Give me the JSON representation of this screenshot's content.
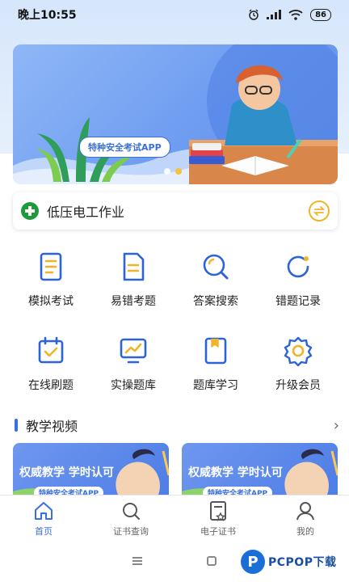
{
  "status_bar": {
    "time": "晚上10:55",
    "battery": "86"
  },
  "banner": {
    "tag": "特种安全考试APP",
    "page_count": 2,
    "active_index": 1
  },
  "job": {
    "title": "低压电工作业"
  },
  "features": [
    {
      "label": "模拟考试",
      "icon": "exam-paper-icon"
    },
    {
      "label": "易错考题",
      "icon": "document-icon"
    },
    {
      "label": "答案搜索",
      "icon": "search-icon"
    },
    {
      "label": "错题记录",
      "icon": "refresh-icon"
    },
    {
      "label": "在线刷题",
      "icon": "calendar-check-icon"
    },
    {
      "label": "实操题库",
      "icon": "monitor-chart-icon"
    },
    {
      "label": "题库学习",
      "icon": "book-icon"
    },
    {
      "label": "升级会员",
      "icon": "gear-icon"
    }
  ],
  "videos_section": {
    "title": "教学视频",
    "items": [
      {
        "title": "权威教学 学时认可",
        "tag": "特种安全考试APP"
      },
      {
        "title": "权威教学 学时认可",
        "tag": "特种安全考试APP"
      }
    ]
  },
  "tabs": [
    {
      "label": "首页",
      "icon": "home-icon",
      "active": true
    },
    {
      "label": "证书查询",
      "icon": "search-icon",
      "active": false
    },
    {
      "label": "电子证书",
      "icon": "certificate-icon",
      "active": false
    },
    {
      "label": "我的",
      "icon": "user-icon",
      "active": false
    }
  ],
  "watermark": {
    "text": "PCPOP下载"
  },
  "colors": {
    "accent": "#3b6fe0",
    "banner": "#6f9df0",
    "switch": "#f0b429",
    "logo_green": "#1e9a3a"
  }
}
